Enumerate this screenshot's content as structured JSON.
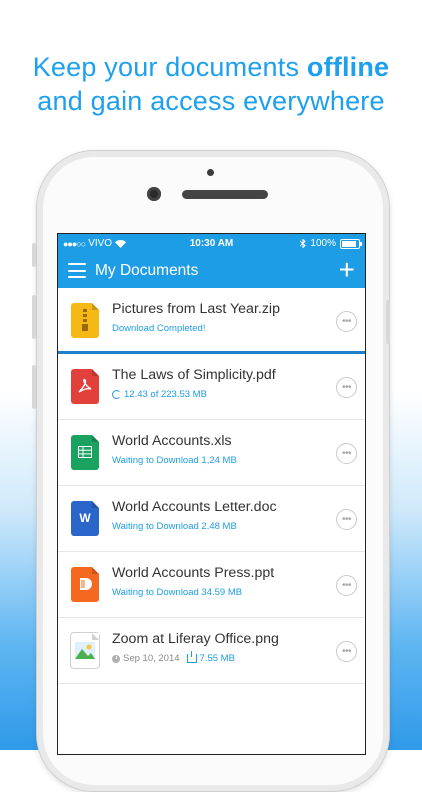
{
  "headline": {
    "line1_prefix": "Keep your documents ",
    "line1_bold": "offline",
    "line2": "and gain access everywhere"
  },
  "statusbar": {
    "carrier": "VIVO",
    "signal": "●●●○○",
    "time": "10:30 AM",
    "battery": "100%",
    "battery_level": 1.0
  },
  "navbar": {
    "title": "My Documents",
    "add_label": "+"
  },
  "colors": {
    "accent": "#1e9de7",
    "zip": "#f5b915",
    "pdf": "#e2413b",
    "xls": "#1aa260",
    "doc": "#2a66c9",
    "ppt": "#f4681f"
  },
  "files": [
    {
      "name": "Pictures from Last Year.zip",
      "status": "Download Completed!",
      "icon": "zip-file-icon",
      "glyph": "≡"
    },
    {
      "name": "The Laws of Simplicity.pdf",
      "status": "12.43 of 223.53 MB",
      "icon": "pdf-file-icon",
      "glyph": "⟆"
    },
    {
      "name": "World Accounts.xls",
      "status": "Waiting to Download 1,24 MB",
      "icon": "spreadsheet-file-icon",
      "glyph": "▦"
    },
    {
      "name": "World Accounts Letter.doc",
      "status": "Waiting to Download 2.48 MB",
      "icon": "word-file-icon",
      "glyph": "W"
    },
    {
      "name": "World Accounts Press.ppt",
      "status": "Waiting to Download 34.59 MB",
      "icon": "presentation-file-icon",
      "glyph": "▮"
    },
    {
      "name": "Zoom at Liferay Office.png",
      "date": "Sep 10, 2014",
      "size": "7.55 MB",
      "icon": "image-file-icon"
    }
  ],
  "more_label": "•••"
}
